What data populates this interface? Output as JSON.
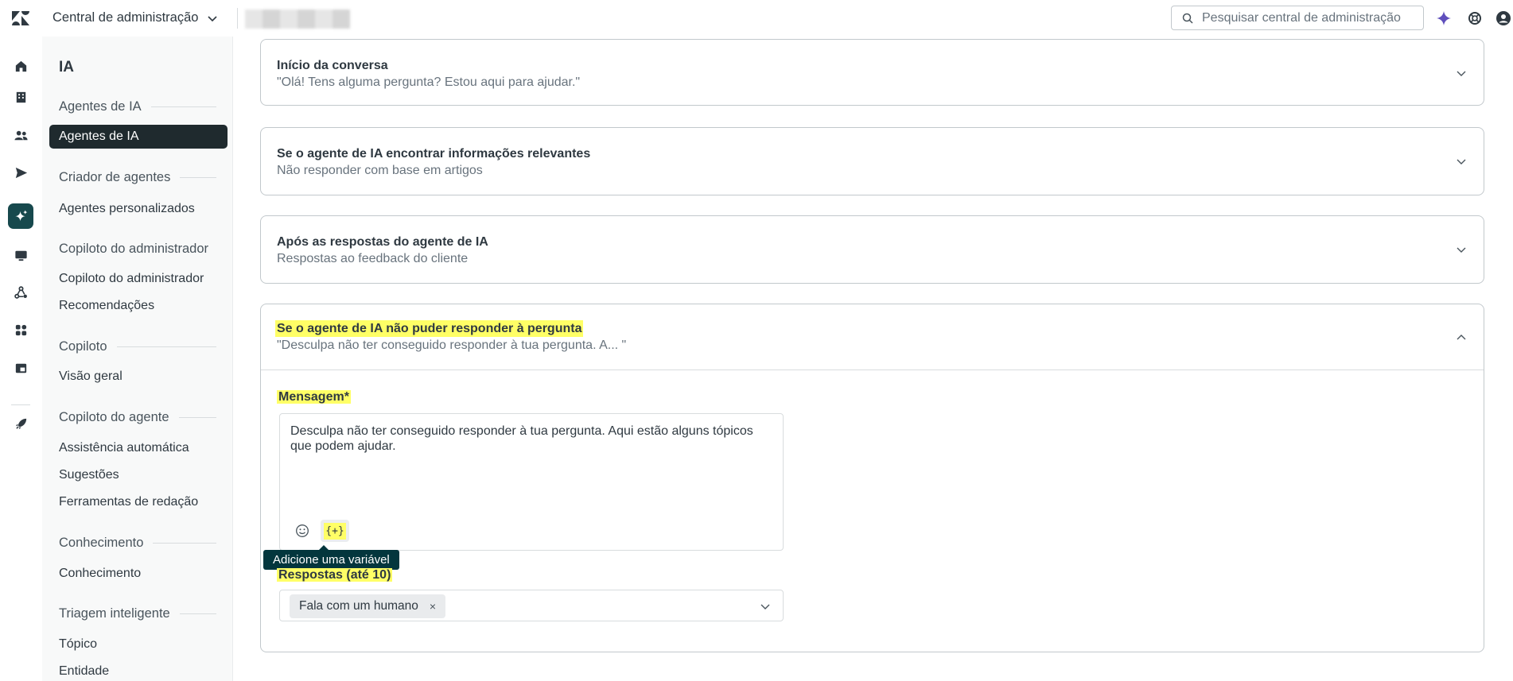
{
  "header": {
    "product_name": "Central de administração",
    "search_placeholder": "Pesquisar central de administração",
    "icons": [
      "zendesk-logo",
      "chevron-down-icon",
      "search-icon",
      "ai-sparkle-icon",
      "help-lifebuoy-icon",
      "user-avatar-icon"
    ],
    "colors": {
      "sparkle": "#5f4fbc",
      "text": "#2f3941"
    }
  },
  "rail": {
    "icons": [
      "home-icon",
      "building-icon",
      "people-icon",
      "send-icon",
      "ai-sparkle-icon",
      "monitor-icon",
      "recycle-icon",
      "apps-grid-icon",
      "workspace-icon",
      "rocket-icon"
    ],
    "active": "ai-sparkle-icon",
    "active_color": "#17494d"
  },
  "sidenav": {
    "title": "IA",
    "groups": [
      {
        "label": "Agentes de IA",
        "items": [
          "Agentes de IA"
        ]
      },
      {
        "label": "Criador de agentes",
        "items": [
          "Agentes personalizados"
        ]
      },
      {
        "label": "Copiloto do administrador",
        "items": [
          "Copiloto do administrador",
          "Recomendações"
        ]
      },
      {
        "label": "Copiloto",
        "items": [
          "Visão geral"
        ]
      },
      {
        "label": "Copiloto do agente",
        "items": [
          "Assistência automática",
          "Sugestões",
          "Ferramentas de redação"
        ]
      },
      {
        "label": "Conhecimento",
        "items": [
          "Conhecimento"
        ]
      },
      {
        "label": "Triagem inteligente",
        "items": [
          "Tópico",
          "Entidade"
        ]
      }
    ],
    "active_item": "Agentes de IA",
    "active_color": "#1f2a2e"
  },
  "main": {
    "cards": [
      {
        "title": "Início da conversa",
        "subtitle": "\"Olá! Tens alguma pergunta? Estou aqui para ajudar.\""
      },
      {
        "title": "Se o agente de IA encontrar informações relevantes",
        "subtitle": "Não responder com base em artigos"
      },
      {
        "title": "Após as respostas do agente de IA",
        "subtitle": "Respostas ao feedback do cliente"
      },
      {
        "title": "Se o agente de IA não puder responder à pergunta",
        "subtitle": "\"Desculpa não ter conseguido responder à tua pergunta. A... \"",
        "expanded": true,
        "message_label": "Mensagem*",
        "message_value": "Desculpa não ter conseguido responder à tua pergunta. Aqui estão alguns tópicos que podem ajudar.",
        "variable_button": "{+}",
        "tooltip": "Adicione uma variável",
        "responses_label": "Respostas (até 10)",
        "responses_tags": [
          "Fala com um humano"
        ],
        "tag_remove": "×"
      }
    ],
    "highlight_color": "#ffff66",
    "tooltip_color": "#03363d"
  }
}
